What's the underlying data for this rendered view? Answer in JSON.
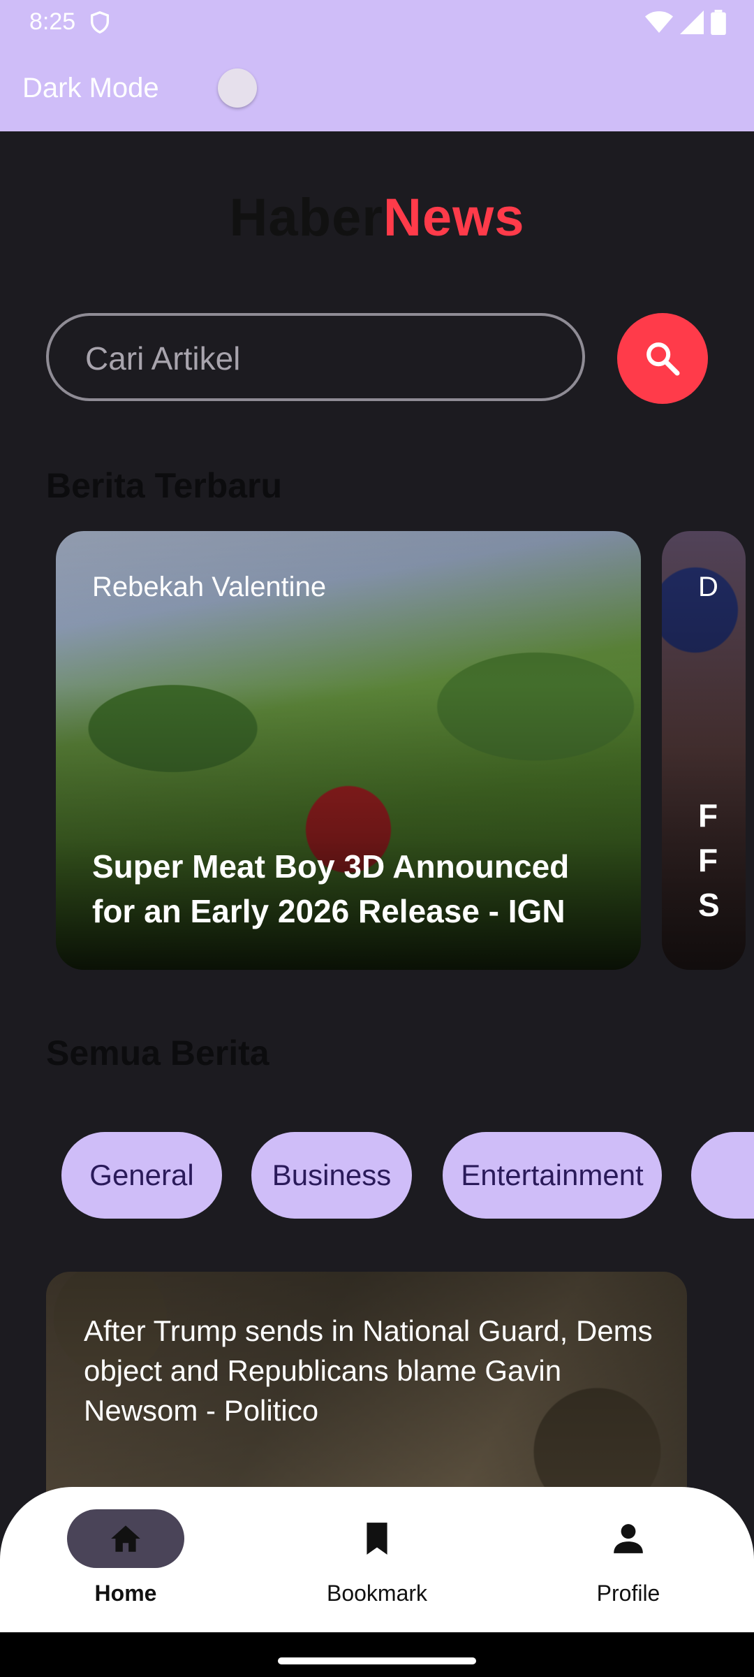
{
  "status_bar": {
    "time": "8:25"
  },
  "app_bar": {
    "dark_mode_label": "Dark Mode",
    "dark_mode_on": false
  },
  "logo": {
    "part1": "Haber",
    "part2": "News",
    "colors": {
      "part1": "#111111",
      "part2": "#ff3b4a"
    }
  },
  "search": {
    "placeholder": "Cari Artikel",
    "value": "",
    "button_icon": "search-icon"
  },
  "latest": {
    "title": "Berita Terbaru",
    "cards": [
      {
        "author": "Rebekah Valentine",
        "title": "Super Meat Boy 3D Announced for an Early 2026 Release - IGN"
      },
      {
        "author_fragment": "D",
        "title_fragments": [
          "F",
          "F",
          "S"
        ]
      }
    ]
  },
  "all_news": {
    "title": "Semua Berita",
    "categories": [
      "General",
      "Business",
      "Entertainment"
    ],
    "articles": [
      {
        "title": "After Trump sends in National Guard, Dems object and Republicans blame Gavin Newsom - Politico"
      }
    ]
  },
  "bottom_nav": {
    "items": [
      {
        "label": "Home",
        "icon": "home-icon",
        "active": true
      },
      {
        "label": "Bookmark",
        "icon": "bookmark-icon",
        "active": false
      },
      {
        "label": "Profile",
        "icon": "person-icon",
        "active": false
      }
    ]
  },
  "colors": {
    "accent": "#ff3b4a",
    "chip": "#cfbdf8",
    "topbar": "#cfbdf8",
    "background": "#1c1b20"
  }
}
